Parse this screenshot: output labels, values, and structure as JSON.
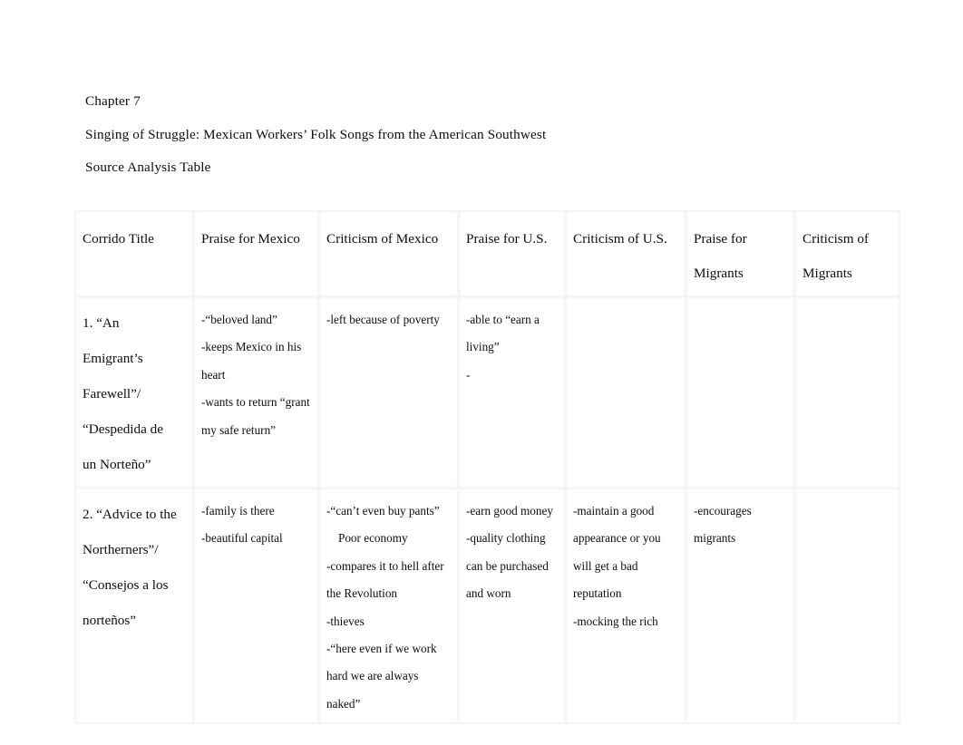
{
  "document": {
    "headings": [
      "Chapter 7",
      "Singing of Struggle: Mexican Workers’ Folk Songs from the American Southwest",
      "Source Analysis Table"
    ]
  },
  "table": {
    "columns": [
      {
        "id": "corrido-title",
        "label_lines": [
          "Corrido Title"
        ]
      },
      {
        "id": "praise-for-mexico",
        "label_lines": [
          "Praise for Mexico"
        ]
      },
      {
        "id": "criticism-of-mexico",
        "label_lines": [
          "Criticism of Mexico"
        ]
      },
      {
        "id": "praise-for-us",
        "label_lines": [
          "Praise for U.S."
        ]
      },
      {
        "id": "criticism-of-us",
        "label_lines": [
          "Criticism of U.S."
        ]
      },
      {
        "id": "praise-for-migrants",
        "label_lines": [
          "Praise for",
          "Migrants"
        ]
      },
      {
        "id": "criticism-of-migrants",
        "label_lines": [
          "Criticism of",
          "Migrants"
        ]
      }
    ],
    "rows": [
      {
        "id": "row-1",
        "title_lines": [
          "1. “An",
          "Emigrant’s",
          "Farewell”/",
          "“Despedida de",
          "un Norteño”"
        ],
        "cells": [
          {
            "column": "praise-for-mexico",
            "lines": [
              {
                "text": "-“beloved land”",
                "indent": false
              },
              {
                "text": "-keeps Mexico in his",
                "indent": false
              },
              {
                "text": "heart",
                "indent": false
              },
              {
                "text": "-wants to return “grant",
                "indent": false
              },
              {
                "text": "my safe return”",
                "indent": false
              }
            ]
          },
          {
            "column": "criticism-of-mexico",
            "lines": [
              {
                "text": "-left because of poverty",
                "indent": false
              }
            ]
          },
          {
            "column": "praise-for-us",
            "lines": [
              {
                "text": "-able to “earn a",
                "indent": false
              },
              {
                "text": "living”",
                "indent": false
              },
              {
                "text": "-",
                "indent": false
              }
            ]
          },
          {
            "column": "criticism-of-us",
            "lines": []
          },
          {
            "column": "praise-for-migrants",
            "lines": []
          },
          {
            "column": "criticism-of-migrants",
            "lines": []
          }
        ]
      },
      {
        "id": "row-2",
        "title_lines": [
          "2. “Advice to the",
          "Northerners”/",
          "“Consejos a los",
          "norteños”"
        ],
        "cells": [
          {
            "column": "praise-for-mexico",
            "lines": [
              {
                "text": "-family is there",
                "indent": false
              },
              {
                "text": "-beautiful capital",
                "indent": false
              }
            ]
          },
          {
            "column": "criticism-of-mexico",
            "lines": [
              {
                "text": "-“can’t even buy pants”",
                "indent": false
              },
              {
                "text": "Poor economy",
                "indent": true
              },
              {
                "text": "-compares it to hell after",
                "indent": false
              },
              {
                "text": "the Revolution",
                "indent": false
              },
              {
                "text": "-thieves",
                "indent": false
              },
              {
                "text": "-“here even if we work",
                "indent": false
              },
              {
                "text": "hard we are always",
                "indent": false
              },
              {
                "text": "naked”",
                "indent": false
              }
            ]
          },
          {
            "column": "praise-for-us",
            "lines": [
              {
                "text": "-earn good money",
                "indent": false
              },
              {
                "text": "-quality clothing",
                "indent": false
              },
              {
                "text": "can be purchased",
                "indent": false
              },
              {
                "text": "and worn",
                "indent": false
              }
            ]
          },
          {
            "column": "criticism-of-us",
            "lines": [
              {
                "text": "-maintain a good",
                "indent": false
              },
              {
                "text": "appearance or you",
                "indent": false
              },
              {
                "text": "will get a bad",
                "indent": false
              },
              {
                "text": "reputation",
                "indent": false
              },
              {
                "text": "-mocking the rich",
                "indent": false
              }
            ]
          },
          {
            "column": "praise-for-migrants",
            "lines": [
              {
                "text": "-encourages",
                "indent": false
              },
              {
                "text": "migrants",
                "indent": false
              }
            ]
          },
          {
            "column": "criticism-of-migrants",
            "lines": []
          }
        ]
      }
    ]
  }
}
